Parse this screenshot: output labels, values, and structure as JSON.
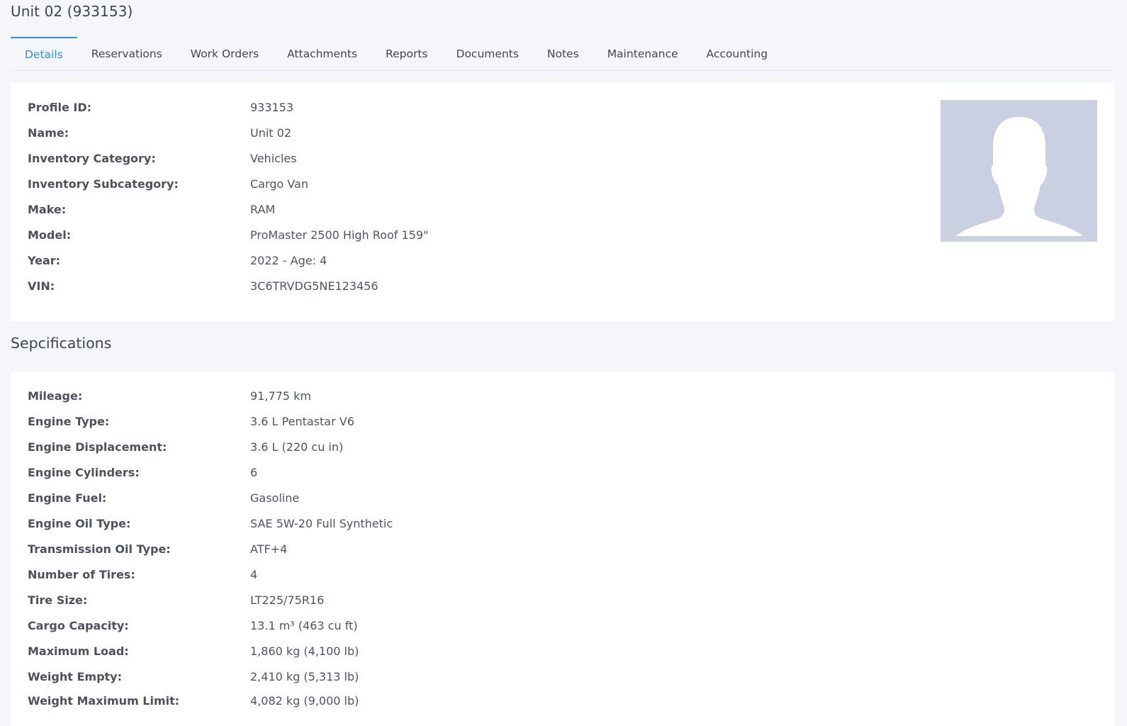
{
  "page": {
    "title": "Unit 02 (933153)"
  },
  "tabs": [
    {
      "label": "Details",
      "active": true
    },
    {
      "label": "Reservations",
      "active": false
    },
    {
      "label": "Work Orders",
      "active": false
    },
    {
      "label": "Attachments",
      "active": false
    },
    {
      "label": "Reports",
      "active": false
    },
    {
      "label": "Documents",
      "active": false
    },
    {
      "label": "Notes",
      "active": false
    },
    {
      "label": "Maintenance",
      "active": false
    },
    {
      "label": "Accounting",
      "active": false
    }
  ],
  "details": {
    "rows": [
      {
        "label": "Profile ID:",
        "value": "933153"
      },
      {
        "label": "Name:",
        "value": "Unit 02"
      },
      {
        "label": "Inventory Category:",
        "value": "Vehicles"
      },
      {
        "label": "Inventory Subcategory:",
        "value": "Cargo Van"
      },
      {
        "label": "Make:",
        "value": "RAM"
      },
      {
        "label": "Model:",
        "value": "ProMaster 2500 High Roof 159\""
      },
      {
        "label": "Year:",
        "value": "2022 - Age: 4"
      },
      {
        "label": "VIN:",
        "value": "3C6TRVDG5NE123456"
      }
    ],
    "avatar_icon": "user-silhouette-icon"
  },
  "specifications": {
    "title": "Sepcifications",
    "rows": [
      {
        "label": "Mileage:",
        "value": "91,775 km"
      },
      {
        "label": "Engine Type:",
        "value": "3.6 L Pentastar V6"
      },
      {
        "label": "Engine Displacement:",
        "value": "3.6 L (220 cu in)"
      },
      {
        "label": "Engine Cylinders:",
        "value": "6"
      },
      {
        "label": "Engine Fuel:",
        "value": "Gasoline"
      },
      {
        "label": "Engine Oil Type:",
        "value": "SAE 5W-20 Full Synthetic"
      },
      {
        "label": "Transmission Oil Type:",
        "value": "ATF+4"
      },
      {
        "label": "Number of Tires:",
        "value": "4"
      },
      {
        "label": "Tire Size:",
        "value": "LT225/75R16"
      },
      {
        "label": "Cargo Capacity:",
        "value": "13.1 m³ (463 cu ft)"
      },
      {
        "label": "Maximum Load:",
        "value": "1,860 kg (4,100 lb)"
      },
      {
        "label": "Weight Empty:",
        "value": "2,410 kg (5,313 lb)"
      },
      {
        "label": "Weight Maximum Limit:",
        "value": "4,082 kg (9,000 lb)"
      }
    ]
  },
  "colors": {
    "accent": "#2e8fd6",
    "background": "#f5f6f9",
    "card": "#ffffff",
    "avatar_bg": "#c8d0e2"
  }
}
